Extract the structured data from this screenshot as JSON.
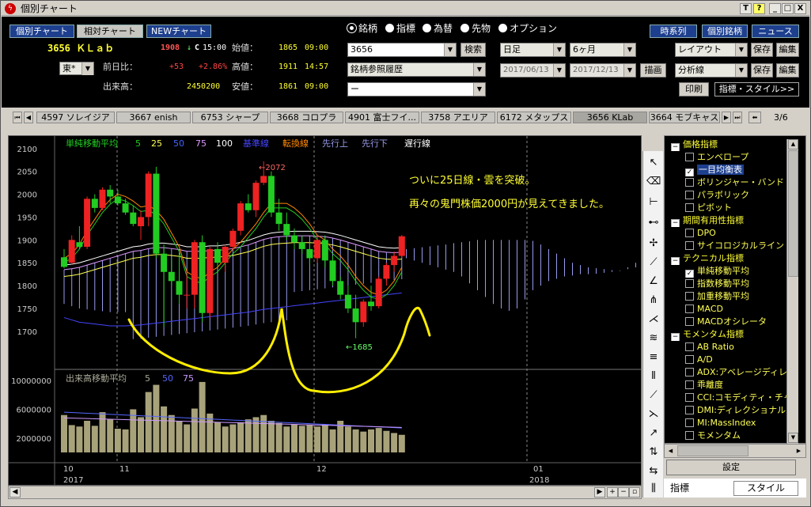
{
  "window": {
    "title": "個別チャート",
    "logo": "ϟ",
    "buttons": [
      "T",
      "?",
      "_",
      "□",
      "X"
    ]
  },
  "nav": {
    "tabs": [
      "個別チャート",
      "相対チャート",
      "NEWチャート"
    ],
    "right": [
      "時系列",
      "個別銘柄",
      "ニュース"
    ]
  },
  "stock": {
    "code_name": "3656 ＫＬａｂ",
    "price": "1908",
    "arrow": "↓",
    "cflag": "C",
    "time": "15:00",
    "change_label": "前日比：",
    "change": "+53",
    "change_pct": "+2.86%",
    "volume_label": "出来高：",
    "volume": "2450200",
    "market": "東*",
    "open_label": "始値：",
    "open": "1865",
    "open_time": "09:00",
    "high_label": "高値：",
    "high": "1911",
    "high_time": "14:57",
    "low_label": "安値：",
    "low": "1861",
    "low_time": "09:00"
  },
  "radios": [
    {
      "label": "銘柄",
      "on": true
    },
    {
      "label": "指標",
      "on": false
    },
    {
      "label": "為替",
      "on": false
    },
    {
      "label": "先物",
      "on": false
    },
    {
      "label": "オプション",
      "on": false
    }
  ],
  "search": {
    "code": "3656",
    "search_btn": "検索",
    "history": "銘柄参照履歴",
    "blank": "ー"
  },
  "period": {
    "unit": "日足",
    "range": "6ヶ月",
    "from": "2017/06/13",
    "to": "2017/12/13",
    "draw_btn": "描画"
  },
  "layout": {
    "layout_sel": "レイアウト",
    "analysis_sel": "分析線",
    "save": "保存",
    "edit": "編集",
    "print": "印刷",
    "style_btn": "指標・スタイル>>"
  },
  "watchlist": {
    "items": [
      "4597 ソレイジア",
      "3667 enish",
      "6753 シャープ",
      "3668 コロプラ",
      "4901 富士フイ...",
      "3758 アエリア",
      "6172 メタップス",
      "3656 KLab",
      "3664 モブキャス"
    ],
    "active": 7,
    "page": "3/6"
  },
  "legend": {
    "sma_label": "単純移動平均",
    "sma": [
      "5",
      "25",
      "50",
      "75",
      "100"
    ],
    "ichimoku": [
      "基準線",
      "転換線",
      "先行上",
      "先行下",
      "遅行線"
    ],
    "vol_label": "出来高移動平均",
    "vol": [
      "5",
      "50",
      "75"
    ]
  },
  "annotations": {
    "note1": "ついに25日線・雲を突破。",
    "note2": "再々の鬼門株価2000円が見えてきました。",
    "peak": "←2072",
    "trough": "←1685"
  },
  "chart_data": {
    "type": "candlestick",
    "title": "",
    "y_price_ticks": [
      "2100",
      "2050",
      "2000",
      "1950",
      "1900",
      "1850",
      "1800",
      "1750",
      "1700"
    ],
    "ylim": [
      1660,
      2110
    ],
    "y_volume_ticks": [
      "10000000",
      "6000000",
      "2000000"
    ],
    "x_ticks": [
      "10",
      "11",
      "12",
      "01"
    ],
    "x_years": [
      "2017",
      "2018"
    ],
    "candles": [
      [
        1862,
        1880,
        1838,
        1841
      ],
      [
        1850,
        1910,
        1845,
        1900
      ],
      [
        1895,
        1930,
        1880,
        1885
      ],
      [
        1885,
        1995,
        1880,
        1990
      ],
      [
        1990,
        2000,
        1960,
        1970
      ],
      [
        1970,
        2015,
        1965,
        2010
      ],
      [
        2010,
        2020,
        1980,
        1995
      ],
      [
        1995,
        2010,
        1975,
        1980
      ],
      [
        1980,
        1990,
        1955,
        1960
      ],
      [
        1960,
        1975,
        1930,
        1935
      ],
      [
        1930,
        1965,
        1900,
        1950
      ],
      [
        1950,
        2050,
        1930,
        2045
      ],
      [
        2045,
        2060,
        1860,
        1870
      ],
      [
        1870,
        1890,
        1710,
        1830
      ],
      [
        1830,
        1860,
        1800,
        1810
      ],
      [
        1810,
        1870,
        1760,
        1780
      ],
      [
        1780,
        1830,
        1750,
        1780
      ],
      [
        1780,
        1900,
        1750,
        1895
      ],
      [
        1895,
        1910,
        1720,
        1740
      ],
      [
        1740,
        1885,
        1730,
        1880
      ],
      [
        1880,
        1895,
        1840,
        1850
      ],
      [
        1850,
        1890,
        1830,
        1885
      ],
      [
        1885,
        1925,
        1880,
        1920
      ],
      [
        1920,
        1985,
        1910,
        1980
      ],
      [
        1980,
        2000,
        1960,
        1965
      ],
      [
        1965,
        2030,
        1950,
        2025
      ],
      [
        2025,
        2072,
        2020,
        2040
      ],
      [
        2040,
        2050,
        1950,
        1960
      ],
      [
        1960,
        1990,
        1920,
        1935
      ],
      [
        1935,
        1960,
        1900,
        1910
      ],
      [
        1910,
        1925,
        1880,
        1895
      ],
      [
        1895,
        1910,
        1870,
        1880
      ],
      [
        1880,
        1895,
        1845,
        1860
      ],
      [
        1860,
        1910,
        1850,
        1900
      ],
      [
        1900,
        1910,
        1840,
        1855
      ],
      [
        1855,
        1865,
        1800,
        1810
      ],
      [
        1810,
        1820,
        1770,
        1780
      ],
      [
        1780,
        1800,
        1740,
        1750
      ],
      [
        1750,
        1780,
        1685,
        1720
      ],
      [
        1720,
        1770,
        1710,
        1765
      ],
      [
        1765,
        1800,
        1745,
        1755
      ],
      [
        1755,
        1820,
        1750,
        1815
      ],
      [
        1815,
        1850,
        1800,
        1845
      ],
      [
        1845,
        1875,
        1830,
        1865
      ],
      [
        1865,
        1911,
        1861,
        1908
      ]
    ],
    "volumes": [
      5200000,
      3800000,
      3600000,
      4400000,
      3700000,
      5600000,
      4600000,
      3300000,
      3200000,
      6000000,
      4900000,
      8400000,
      9400000,
      6400000,
      5200000,
      4400000,
      3900000,
      6100000,
      9800000,
      5400000,
      4200000,
      3600000,
      3900000,
      4200000,
      4600000,
      4900000,
      5200000,
      4400000,
      4100000,
      3600000,
      3900000,
      3700000,
      3800000,
      3600000,
      3900000,
      3200000,
      4400000,
      3600000,
      3200000,
      2900000,
      3200000,
      3400000,
      3000000,
      2700000,
      2450000
    ],
    "sma5": [
      1850,
      1860,
      1880,
      1910,
      1935,
      1960,
      1978,
      1990,
      1985,
      1975,
      1962,
      1965,
      1955,
      1935,
      1905,
      1875,
      1820,
      1810,
      1805,
      1820,
      1830,
      1850,
      1870,
      1885,
      1905,
      1925,
      1950,
      1970,
      1970,
      1970,
      1960,
      1945,
      1925,
      1900,
      1890,
      1870,
      1855,
      1835,
      1810,
      1790,
      1775,
      1770,
      1780,
      1800,
      1830
    ],
    "sma25": [
      1820,
      1822,
      1825,
      1830,
      1835,
      1840,
      1845,
      1850,
      1855,
      1860,
      1862,
      1866,
      1868,
      1868,
      1866,
      1864,
      1860,
      1860,
      1860,
      1862,
      1862,
      1864,
      1866,
      1870,
      1874,
      1880,
      1886,
      1890,
      1892,
      1893,
      1894,
      1894,
      1894,
      1893,
      1892,
      1889,
      1885,
      1880,
      1875,
      1870,
      1865,
      1860,
      1858,
      1857,
      1858
    ],
    "sma75": [
      1800,
      1795,
      1790,
      1788,
      1786,
      1784,
      1782,
      1782,
      1782,
      1783,
      1784,
      1786,
      1788,
      1790,
      1792,
      1794,
      1796,
      1798,
      1800,
      1802,
      1804,
      1806,
      1808,
      1810,
      1812,
      1815,
      1818,
      1820,
      1822,
      1824,
      1826,
      1828,
      1830,
      1832,
      1834,
      1836,
      1838,
      1840,
      1842,
      1844,
      1846,
      1848,
      1850,
      1852,
      1854
    ],
    "cloud_future": [
      1860,
      1855,
      1850,
      1845,
      1840,
      1835,
      1830,
      1820,
      1805,
      1790,
      1775,
      1760,
      1750,
      1745,
      1750,
      1770,
      1790,
      1800,
      1810,
      1815,
      1820,
      1822,
      1825,
      1825,
      1826,
      1828,
      1830,
      1832,
      1840,
      1850
    ],
    "cloud_future_top": [
      1880,
      1882,
      1884,
      1886,
      1888,
      1890,
      1893,
      1895,
      1897,
      1900,
      1900,
      1900,
      1900,
      1900,
      1900,
      1900,
      1898,
      1890,
      1880,
      1870,
      1860,
      1850,
      1845,
      1840,
      1838,
      1836,
      1834,
      1833,
      1836,
      1840
    ]
  },
  "right_panel": {
    "items": [
      {
        "t": "g",
        "label": "価格指標"
      },
      {
        "t": "c",
        "label": "エンベロープ",
        "on": false
      },
      {
        "t": "c",
        "label": "一目均衡表",
        "on": true,
        "hl": true
      },
      {
        "t": "c",
        "label": "ボリンジャー・バンド",
        "on": false
      },
      {
        "t": "c",
        "label": "パラボリック",
        "on": false
      },
      {
        "t": "c",
        "label": "ピボット",
        "on": false
      },
      {
        "t": "g",
        "label": "期間有用性指標"
      },
      {
        "t": "c",
        "label": "DPO",
        "on": false
      },
      {
        "t": "c",
        "label": "サイコロジカルライン",
        "on": false
      },
      {
        "t": "g",
        "label": "テクニカル指標"
      },
      {
        "t": "c",
        "label": "単純移動平均",
        "on": true
      },
      {
        "t": "c",
        "label": "指数移動平均",
        "on": false
      },
      {
        "t": "c",
        "label": "加重移動平均",
        "on": false
      },
      {
        "t": "c",
        "label": "MACD",
        "on": false
      },
      {
        "t": "c",
        "label": "MACDオシレータ",
        "on": false
      },
      {
        "t": "g",
        "label": "モメンタム指標"
      },
      {
        "t": "c",
        "label": "AB Ratio",
        "on": false
      },
      {
        "t": "c",
        "label": "A/D",
        "on": false
      },
      {
        "t": "c",
        "label": "ADX:アベレージディレ",
        "on": false
      },
      {
        "t": "c",
        "label": "乖離度",
        "on": false
      },
      {
        "t": "c",
        "label": "CCI:コモディティ・チャ",
        "on": false
      },
      {
        "t": "c",
        "label": "DMI:ディレクショナル",
        "on": false
      },
      {
        "t": "c",
        "label": "MI:MassIndex",
        "on": false
      },
      {
        "t": "c",
        "label": "モメンタム",
        "on": false
      }
    ],
    "settings_btn": "設定",
    "tab_indicator": "指標",
    "tab_style": "スタイル"
  },
  "colors": {
    "sma5": "#22cc22",
    "sma25": "#ffff55",
    "sma50": "#4466ff",
    "sma75": "#dd99ff",
    "sma100": "#ffffff",
    "up": "#ee2222",
    "down": "#22cc22",
    "cloud": "#9999ee",
    "base": "#4444ff",
    "conv": "#ff8800",
    "annot": "#ffff33"
  }
}
